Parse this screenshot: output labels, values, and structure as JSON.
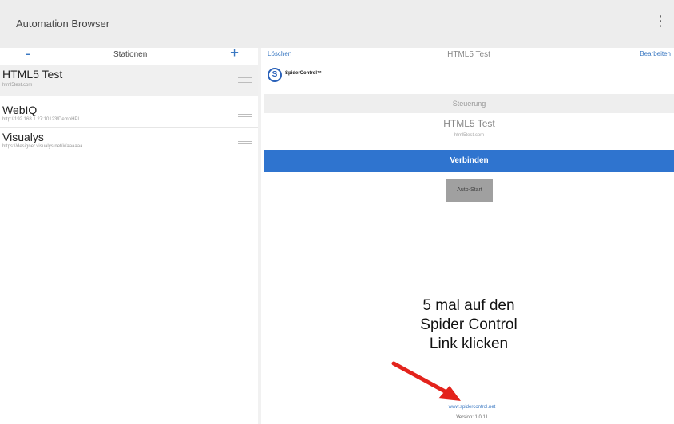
{
  "app": {
    "title": "Automation Browser",
    "menu_icon": "more-vert-icon"
  },
  "stations_panel": {
    "remove_symbol": "-",
    "title": "Stationen",
    "add_symbol": "+",
    "items": [
      {
        "name": "HTML5 Test",
        "url": "html5test.com",
        "selected": true
      },
      {
        "name": "WebIQ",
        "url": "http://192.168.1.27:10123/DemoHPI",
        "selected": false
      },
      {
        "name": "Visualys",
        "url": "https://designer.visualys.net/#/aaaaaa",
        "selected": false
      }
    ]
  },
  "detail": {
    "delete_label": "Löschen",
    "title": "HTML5 Test",
    "edit_label": "Bearbeiten",
    "logo_mark": "S",
    "logo_text": "SpiderControl™",
    "section_label": "Steuerung",
    "station_name": "HTML5 Test",
    "station_url": "html5test.com",
    "connect_label": "Verbinden",
    "autostart_label": "Auto-Start",
    "footer_link": "www.spidercontrol.net",
    "version": "Version: 1.0.11"
  },
  "annotation": {
    "lines": [
      "5 mal auf den",
      "Spider Control",
      "Link klicken"
    ],
    "arrow_color": "#e3231c"
  },
  "colors": {
    "accent": "#2f74cf",
    "link": "#3a78c2",
    "app_bar": "#ededed"
  }
}
